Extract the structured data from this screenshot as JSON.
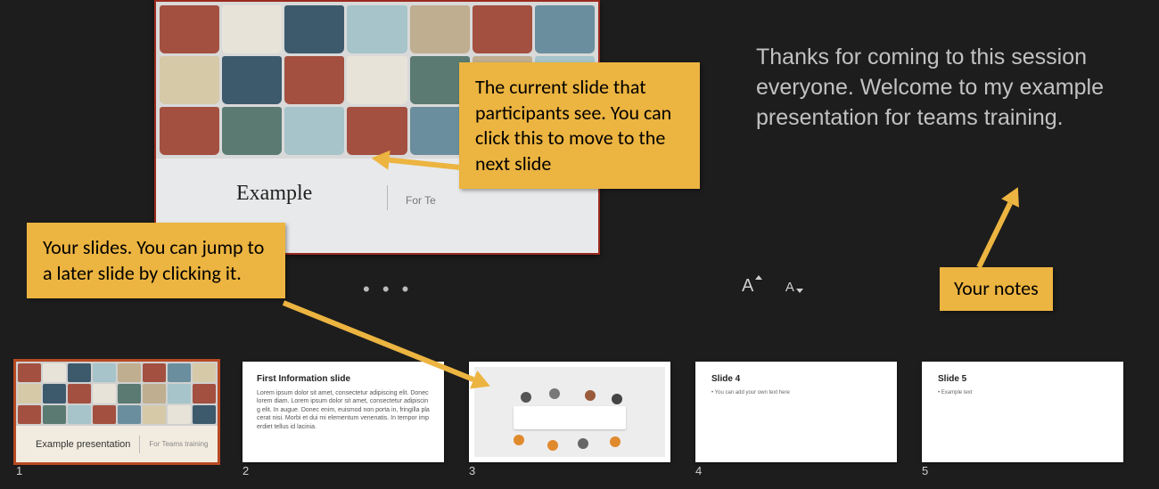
{
  "current_slide": {
    "title": "Example",
    "subtitle": "For Te"
  },
  "notes": {
    "text": "Thanks for coming to this session everyone. Welcome to my example presentation for teams training."
  },
  "font_controls": {
    "increase_label": "A",
    "decrease_label": "A"
  },
  "toolbar": {
    "ellipsis": "• • •"
  },
  "thumbnails": [
    {
      "num": "1",
      "title": "Example presentation",
      "subtitle": "For Teams training",
      "selected": true
    },
    {
      "num": "2",
      "title": "First Information slide",
      "body": "Lorem ipsum dolor sit amet, consectetur adipiscing elit. Donec lorem diam. Lorem ipsum dolor sit amet, consectetur adipiscing elit. In augue. Donec enim, euismod non porta in, fringilla placerat nisi. Morbi et dui mi elementum venenatis. In tempor imperdiet tellus id lacinia.",
      "selected": false
    },
    {
      "num": "3",
      "selected": false
    },
    {
      "num": "4",
      "title": "Slide 4",
      "body": "• You can add your own text here",
      "selected": false
    },
    {
      "num": "5",
      "title": "Slide 5",
      "body": "• Example text",
      "selected": false
    }
  ],
  "annotations": {
    "current_slide": "The current slide that participants see. You can click this to move to the next slide",
    "thumbs": "Your slides. You can jump to a later slide by clicking it.",
    "notes": "Your notes"
  }
}
